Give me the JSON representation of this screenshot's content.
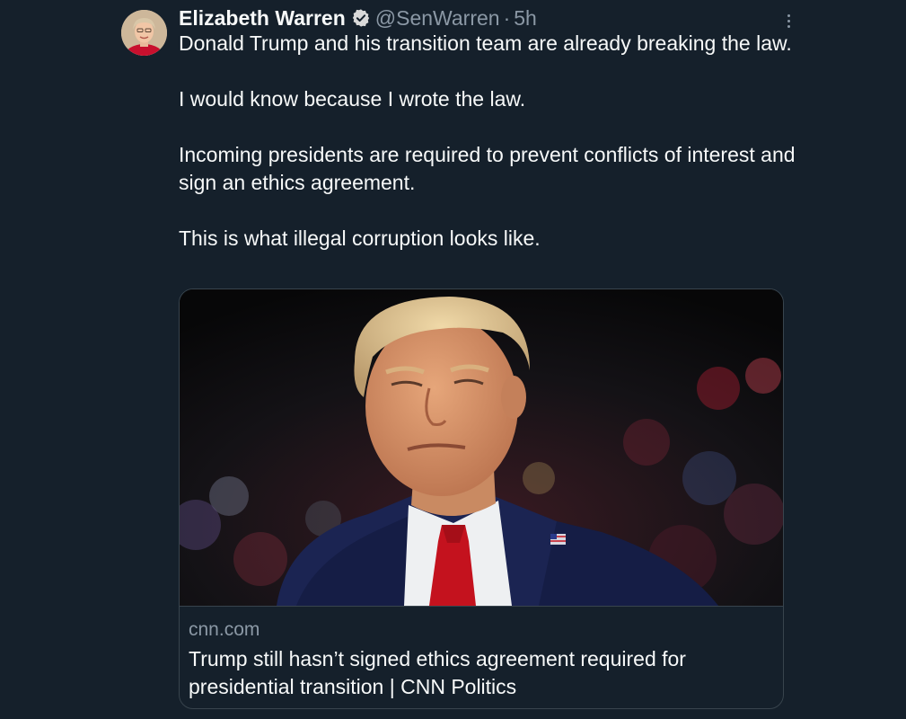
{
  "author": {
    "name": "Elizabeth Warren",
    "handle": "@SenWarren",
    "separator": "·",
    "time": "5h",
    "verified": true,
    "avatar_icon": "profile-photo"
  },
  "tweet": {
    "paragraphs": [
      "Donald Trump and his transition team are already breaking the law.",
      "I would know because I wrote the law.",
      "Incoming presidents are required to prevent conflicts of interest and sign an ethics agreement.",
      "This is what illegal corruption looks like."
    ]
  },
  "link_card": {
    "domain": "cnn.com",
    "title": "Trump still hasn’t signed ethics agreement required for presidential transition | CNN Politics",
    "image_icon": "article-photo"
  },
  "icons": {
    "verified": "verified-badge-icon",
    "more": "more-options-icon"
  },
  "colors": {
    "background": "#15202b",
    "text_primary": "#f7f9f9",
    "text_secondary": "#8b98a5",
    "border": "#38444d"
  }
}
